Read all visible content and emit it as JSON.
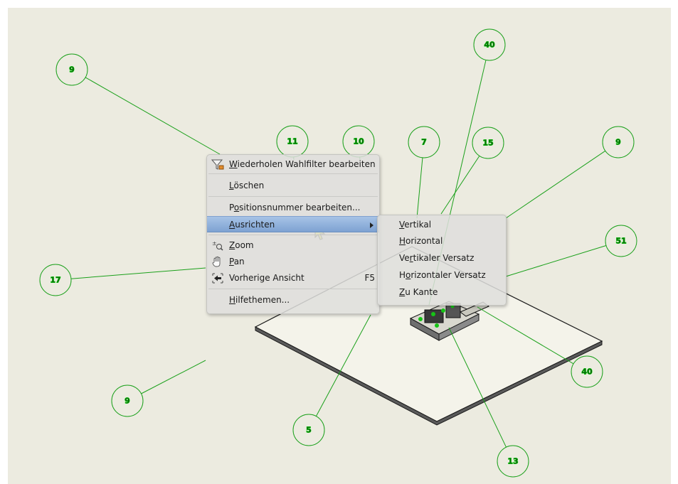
{
  "balloons": [
    "9",
    "40",
    "11",
    "10",
    "7",
    "15",
    "9",
    "51",
    "17",
    "40",
    "9",
    "5",
    "13"
  ],
  "context_menu": {
    "items": [
      {
        "label": "Wiederholen Wahlfilter bearbeiten",
        "mnemonic": "W",
        "rest": "iederholen Wahlfilter bearbeiten",
        "icon": "filter-icon"
      },
      {
        "label": "Löschen",
        "mnemonic": "L",
        "rest": "öschen"
      },
      {
        "label": "Positionsnummer bearbeiten...",
        "pre": "P",
        "mnemonic": "o",
        "rest": "sitionsnummer bearbeiten..."
      },
      {
        "label": "Ausrichten",
        "mnemonic": "A",
        "rest": "usrichten",
        "submenu": true,
        "highlighted": true
      },
      {
        "label": "Zoom",
        "mnemonic": "Z",
        "rest": "oom",
        "icon": "zoom-icon"
      },
      {
        "label": "Pan",
        "mnemonic": "P",
        "rest": "an",
        "icon": "pan-hand-icon"
      },
      {
        "label": "Vorherige Ansicht",
        "shortcut": "F5",
        "icon": "previous-view-icon"
      },
      {
        "label": "Hilfethemen...",
        "mnemonic": "H",
        "rest": "ilfethemen..."
      }
    ]
  },
  "submenu": {
    "items": [
      {
        "label": "Vertikal",
        "mnemonic": "V",
        "rest": "ertikal"
      },
      {
        "label": "Horizontal",
        "mnemonic": "H",
        "rest": "orizontal"
      },
      {
        "label": "Vertikaler Versatz",
        "pre": "Ve",
        "mnemonic": "r",
        "rest": "tikaler Versatz"
      },
      {
        "label": "Horizontaler Versatz",
        "pre": "H",
        "mnemonic": "o",
        "rest": "rizontaler Versatz"
      },
      {
        "label": "Zu Kante",
        "mnemonic": "Z",
        "rest": "u Kante"
      }
    ]
  },
  "colors": {
    "canvas": "#ecebe0",
    "leader": "#1aa01a",
    "highlight": "#8fb0dc"
  }
}
